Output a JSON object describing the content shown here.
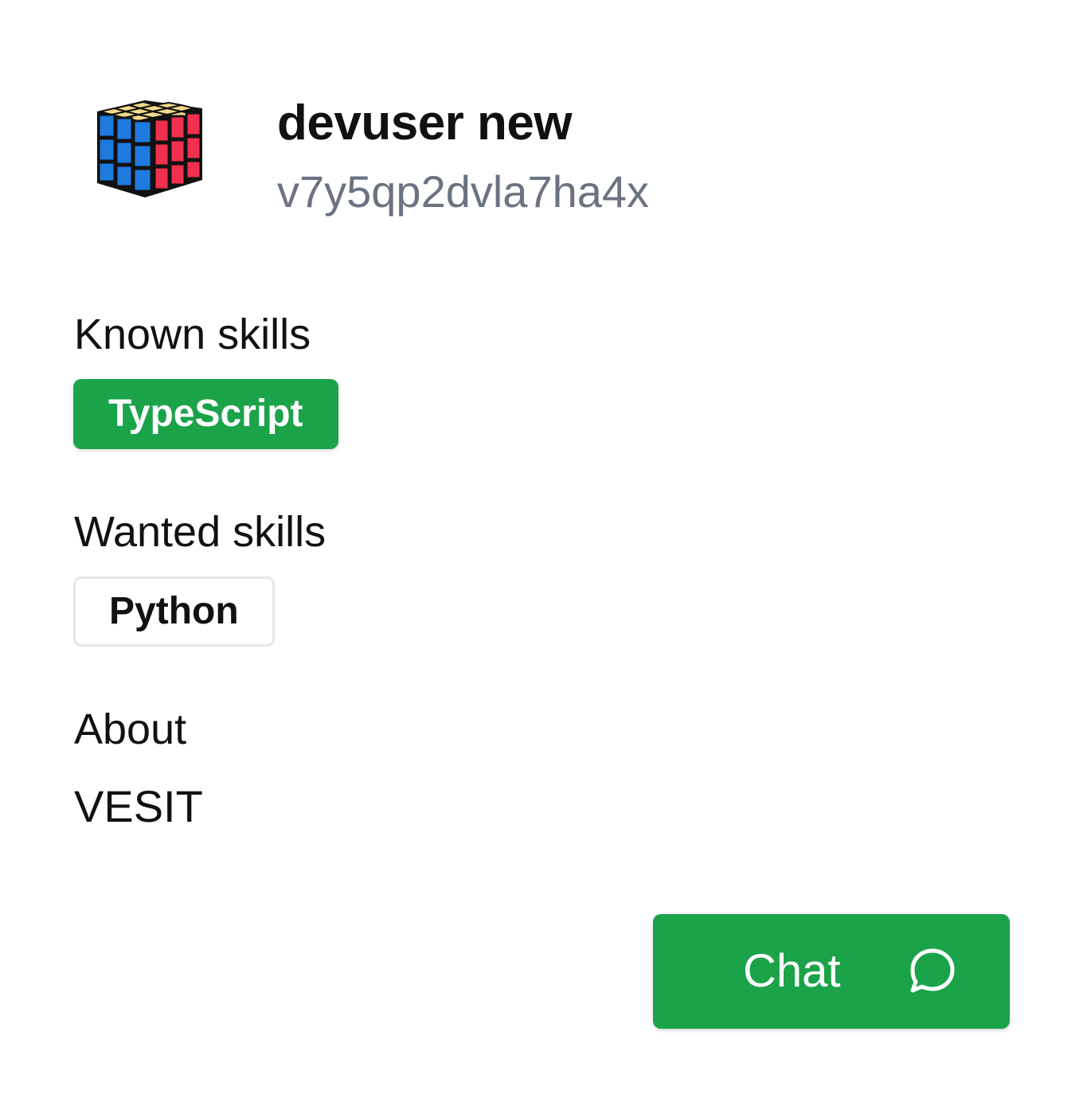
{
  "profile": {
    "avatar_icon": "rubiks-cube-icon",
    "name": "devuser new",
    "handle": "v7y5qp2dvla7ha4x"
  },
  "known_skills": {
    "heading": "Known skills",
    "items": [
      "TypeScript"
    ]
  },
  "wanted_skills": {
    "heading": "Wanted skills",
    "items": [
      "Python"
    ]
  },
  "about": {
    "heading": "About",
    "text": "VESIT"
  },
  "chat_button": {
    "label": "Chat",
    "icon": "chat-bubble-icon"
  },
  "colors": {
    "accent_green": "#1ba34a",
    "muted_text": "#6b7280",
    "chip_border": "#e5e7eb"
  }
}
